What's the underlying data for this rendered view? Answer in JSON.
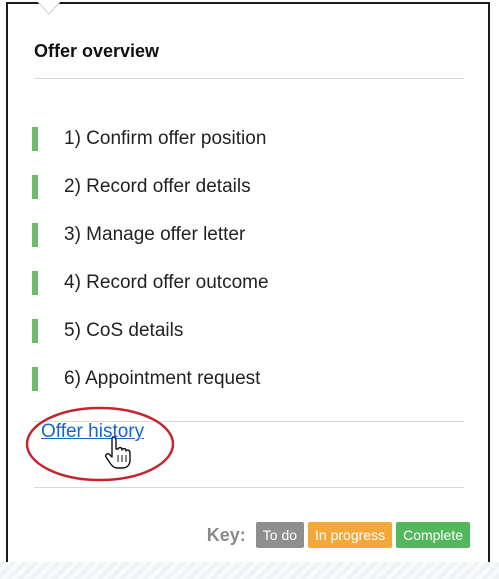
{
  "panel": {
    "title": "Offer overview",
    "steps": [
      {
        "label": "1) Confirm offer position",
        "status": "complete"
      },
      {
        "label": "2) Record offer details",
        "status": "complete"
      },
      {
        "label": "3) Manage offer letter",
        "status": "complete"
      },
      {
        "label": "4) Record offer outcome",
        "status": "complete"
      },
      {
        "label": "5) CoS details",
        "status": "complete"
      },
      {
        "label": "6) Appointment request",
        "status": "complete"
      }
    ],
    "history_link": "Offer history"
  },
  "key": {
    "label": "Key:",
    "todo": "To do",
    "in_progress": "In progress",
    "complete": "Complete"
  },
  "colors": {
    "complete": "#53b75c",
    "in_progress": "#f4a83a",
    "todo": "#8f8f8f",
    "link": "#1a64c8",
    "annotation": "#c4262e"
  },
  "icons": {
    "cursor": "hand-pointer-icon"
  }
}
